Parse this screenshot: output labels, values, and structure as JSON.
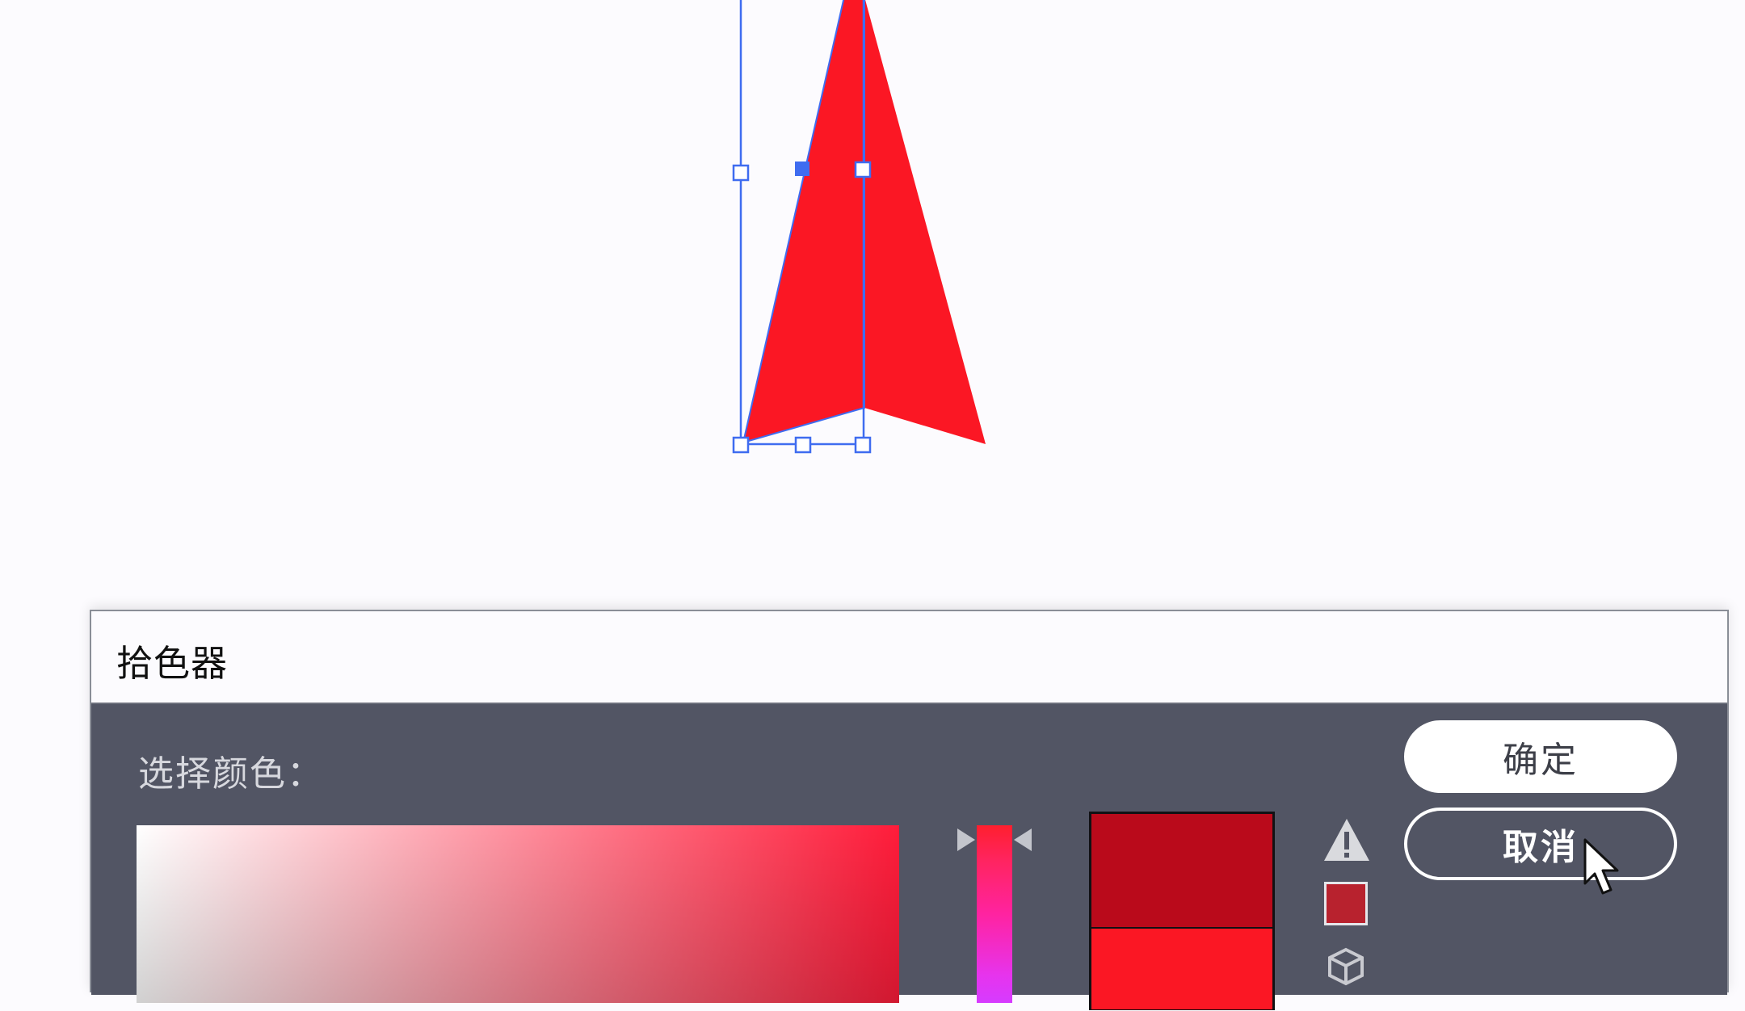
{
  "dialog": {
    "title": "拾色器",
    "select_label": "选择颜色：",
    "ok_label": "确定",
    "cancel_label": "取消"
  },
  "colors": {
    "shape_fill": "#fb1724",
    "selection": "#3f6cf0",
    "new_color": "#ba0a1b",
    "current_color": "#fb1724",
    "gamut_color": "#b8222e",
    "dialog_bg": "#525564"
  },
  "icons": {
    "warning": "warning-icon",
    "cube": "cube-icon",
    "cursor": "mouse-cursor-icon"
  }
}
